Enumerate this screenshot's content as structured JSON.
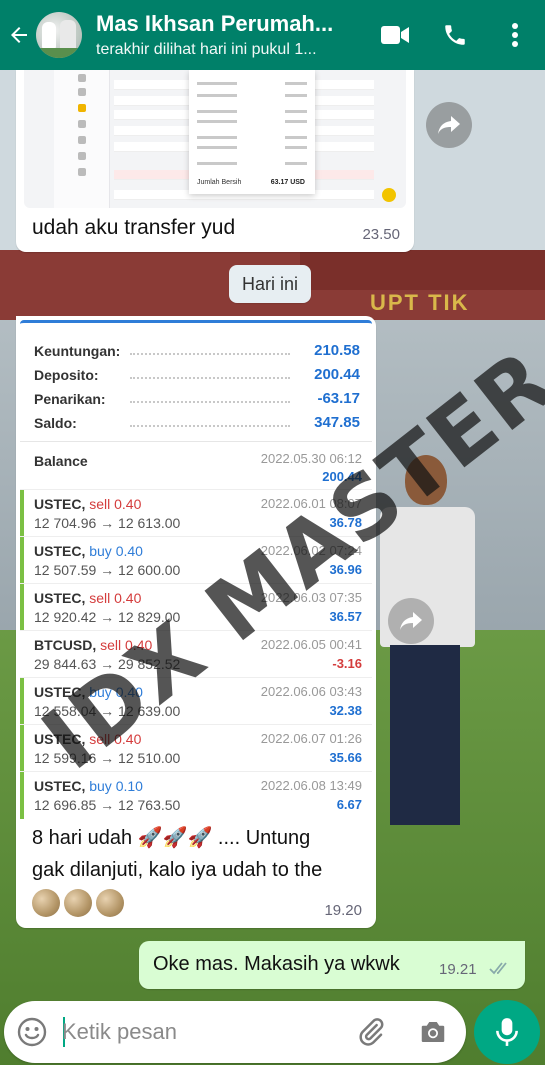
{
  "header": {
    "contact_name": "Mas Ikhsan Perumah...",
    "last_seen": "terakhir dilihat hari ini pukul 1..."
  },
  "messages": {
    "screenshot_caption": "udah aku transfer yud",
    "screenshot_time": "23.50",
    "screenshot_total_label": "Jumlah Bersih",
    "screenshot_total_value": "63.17 USD",
    "date_chip": "Hari ini",
    "trade_caption_line1_a": "8 hari udah",
    "trade_caption_line1_b": ".... Untung",
    "trade_caption_line2": "gak dilanjuti, kalo iya udah to the",
    "trade_time": "19.20",
    "rocket": "🚀",
    "outgoing_text": "Oke mas. Makasih ya wkwk",
    "outgoing_time": "19.21"
  },
  "summary": [
    {
      "label": "Keuntungan:",
      "value": "210.58"
    },
    {
      "label": "Deposito:",
      "value": "200.44"
    },
    {
      "label": "Penarikan:",
      "value": "-63.17"
    },
    {
      "label": "Saldo:",
      "value": "347.85"
    }
  ],
  "balance": {
    "label": "Balance",
    "date": "2022.05.30 06:12",
    "value": "200.44"
  },
  "trades": [
    {
      "symbol": "USTEC,",
      "side": "sell 0.40",
      "type": "sell",
      "prices": "12 704.96 → 12 613.00",
      "date": "2022.06.01 08:07",
      "pl": "36.78"
    },
    {
      "symbol": "USTEC,",
      "side": "buy 0.40",
      "type": "buy",
      "prices": "12 507.59 → 12 600.00",
      "date": "2022.06.02 07:24",
      "pl": "36.96"
    },
    {
      "symbol": "USTEC,",
      "side": "sell 0.40",
      "type": "sell",
      "prices": "12 920.42 → 12 829.00",
      "date": "2022.06.03 07:35",
      "pl": "36.57"
    },
    {
      "symbol": "BTCUSD,",
      "side": "sell 0.40",
      "type": "sell",
      "prices": "29 844.63 → 29 852.52",
      "date": "2022.06.05 00:41",
      "pl": "-3.16"
    },
    {
      "symbol": "USTEC,",
      "side": "buy 0.40",
      "type": "buy",
      "prices": "12 558.04 → 12 639.00",
      "date": "2022.06.06 03:43",
      "pl": "32.38"
    },
    {
      "symbol": "USTEC,",
      "side": "sell 0.40",
      "type": "sell",
      "prices": "12 599.16 → 12 510.00",
      "date": "2022.06.07 01:26",
      "pl": "35.66"
    },
    {
      "symbol": "USTEC,",
      "side": "buy 0.10",
      "type": "buy",
      "prices": "12 696.85 → 12 763.50",
      "date": "2022.06.08 13:49",
      "pl": "6.67"
    }
  ],
  "watermark": "IDX MASTER",
  "wallpaper_sign": "UPT TIK",
  "input": {
    "placeholder": "Ketik pesan"
  },
  "colors": {
    "header": "#008069",
    "accent": "#00a884",
    "outgoing_bubble": "#d9fdd3",
    "profit": "#1f6fd0",
    "loss": "#d43c3c"
  }
}
